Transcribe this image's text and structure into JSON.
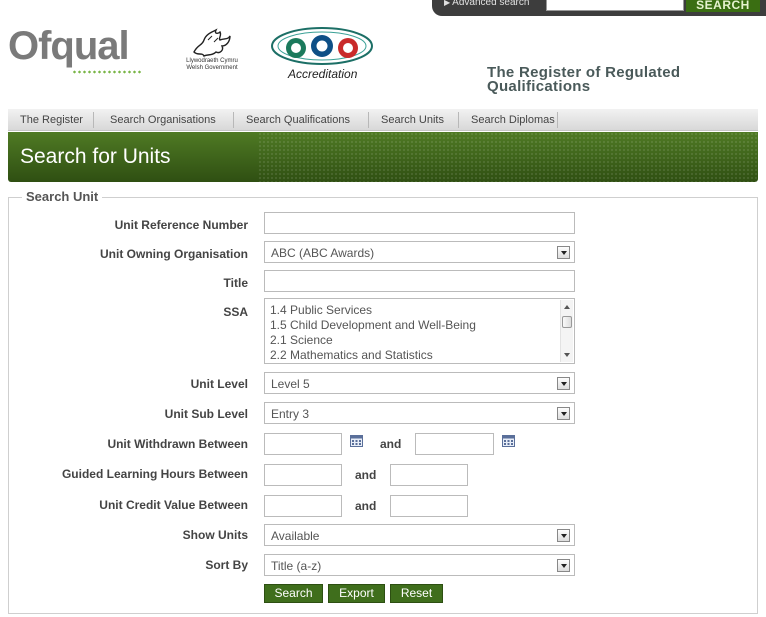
{
  "top_search": {
    "advanced_link": "Advanced search",
    "input_value": "",
    "button_label": "SEARCH"
  },
  "header": {
    "logo_ofqual": "Ofqual",
    "welsh_gov_line1": "Llywodraeth Cymru",
    "welsh_gov_line2": "Welsh Government",
    "cea_accreditation": "Accreditation",
    "site_title_line1": "The Register of Regulated",
    "site_title_line2": "Qualifications"
  },
  "nav": {
    "items": [
      {
        "label": "The Register"
      },
      {
        "label": "Search Organisations"
      },
      {
        "label": "Search Qualifications"
      },
      {
        "label": "Search Units"
      },
      {
        "label": "Search Diplomas"
      }
    ]
  },
  "banner": {
    "title": "Search for Units"
  },
  "form": {
    "legend": "Search Unit",
    "unit_reference_number": {
      "label": "Unit Reference Number",
      "value": ""
    },
    "unit_owning_organisation": {
      "label": "Unit Owning Organisation",
      "value": "ABC (ABC Awards)"
    },
    "title": {
      "label": "Title",
      "value": ""
    },
    "ssa": {
      "label": "SSA",
      "options": [
        "1.4 Public Services",
        "1.5 Child Development and Well-Being",
        "2.1 Science",
        "2.2 Mathematics and Statistics"
      ]
    },
    "unit_level": {
      "label": "Unit Level",
      "value": "Level 5"
    },
    "unit_sub_level": {
      "label": "Unit Sub Level",
      "value": "Entry 3"
    },
    "unit_withdrawn_between": {
      "label": "Unit Withdrawn Between",
      "from": "",
      "to": "",
      "and_label": "and"
    },
    "guided_learning_hours_between": {
      "label": "Guided Learning Hours Between",
      "from": "",
      "to": "",
      "and_label": "and"
    },
    "unit_credit_value_between": {
      "label": "Unit Credit Value Between",
      "from": "",
      "to": "",
      "and_label": "and"
    },
    "show_units": {
      "label": "Show Units",
      "value": "Available"
    },
    "sort_by": {
      "label": "Sort By",
      "value": "Title (a-z)"
    },
    "buttons": {
      "search": "Search",
      "export": "Export",
      "reset": "Reset"
    }
  },
  "colors": {
    "brand_green": "#3f6e1c",
    "banner_top": "#4f7a24",
    "banner_bottom": "#2f4f12",
    "ofqual_grey": "#7a7a7a",
    "ofqual_dots": "#7ab648"
  }
}
